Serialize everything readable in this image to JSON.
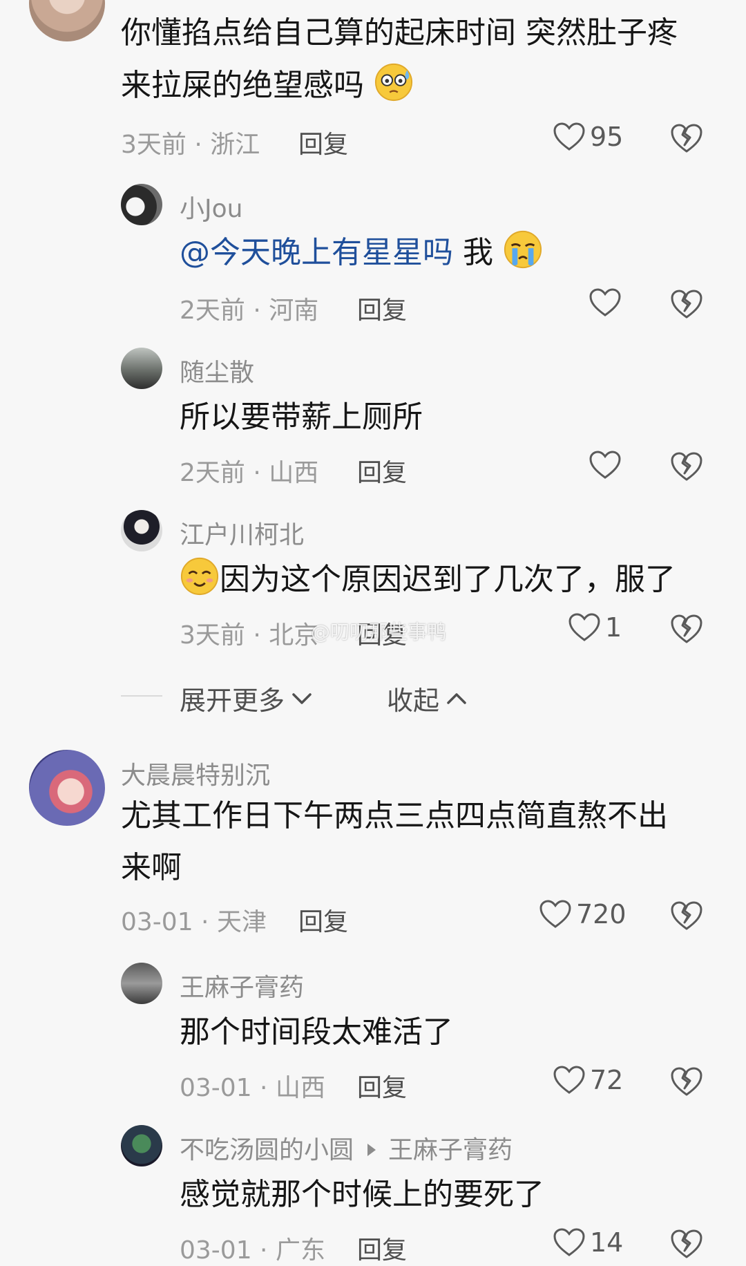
{
  "comments": [
    {
      "text_lines": [
        "你懂掐点给自己算的起床时间 突然肚子疼",
        "来拉屎的绝望感吗"
      ],
      "meta": "3天前 · 浙江",
      "reply": "回复",
      "likes": "95"
    },
    {
      "username": "小Jou",
      "mention": "@今天晚上有星星吗",
      "text": "我",
      "meta": "2天前 · 河南",
      "reply": "回复"
    },
    {
      "username": "随尘散",
      "text": "所以要带薪上厕所",
      "meta": "2天前 · 山西",
      "reply": "回复"
    },
    {
      "username": "江户川柯北",
      "text": "因为这个原因迟到了几次了，服了",
      "meta": "3天前 · 北京",
      "reply": "回复",
      "likes": "1"
    },
    {
      "username": "大晨晨特别沉",
      "text_lines": [
        "尤其工作日下午两点三点四点简直熬不出",
        "来啊"
      ],
      "meta": "03-01 · 天津",
      "reply": "回复",
      "likes": "720"
    },
    {
      "username": "王麻子膏药",
      "text": "那个时间段太难活了",
      "meta": "03-01 · 山西",
      "reply": "回复",
      "likes": "72"
    },
    {
      "username": "不吃汤圆的小圆",
      "reply_to": "王麻子膏药",
      "text": "感觉就那个时候上的要死了",
      "meta": "03-01 · 广东",
      "reply": "回复",
      "likes": "14"
    }
  ],
  "thread_controls": {
    "expand_more": "展开更多",
    "collapse": "收起"
  },
  "watermark": "@叨叨那些事鸭",
  "icons": [
    "heart-icon",
    "dislike-icon",
    "chevron-down-icon",
    "chevron-up-icon"
  ],
  "colors": {
    "mention": "#1f4f9b",
    "secondary_text": "#9a9a9a",
    "background": "#f7f7f7"
  }
}
